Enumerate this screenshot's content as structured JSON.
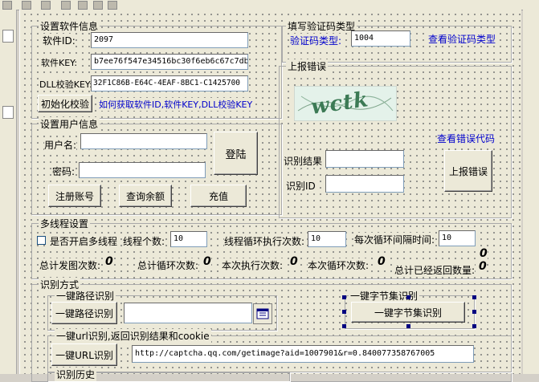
{
  "software": {
    "title": "设置软件信息",
    "id_label": "软件ID:",
    "id_value": "2097",
    "key_label": "软件KEY:",
    "key_value": "b7ee76f547e34516bc30f6eb6c67c7db",
    "dll_label": "DLL校验KEY:",
    "dll_value": "32F1C86B-E64C-4EAF-8BC1-C1425700",
    "init_button": "初始化校验",
    "howto_link": "如何获取软件ID,软件KEY,DLL校验KEY"
  },
  "user": {
    "title": "设置用户信息",
    "username_label": "用户名:",
    "username_value": "",
    "password_label": "密码:",
    "password_value": "",
    "login_button": "登陆",
    "register_button": "注册账号",
    "balance_button": "查询余额",
    "recharge_button": "充值"
  },
  "captcha_type": {
    "title": "填写验证码类型",
    "type_label": "验证码类型:",
    "type_value": "1004",
    "view_link": "查看验证码类型"
  },
  "report": {
    "title": "上报错误",
    "captcha_text": "wctk",
    "error_code_link": "查看错误代码",
    "result_label": "识别结果",
    "result_value": "",
    "id_label": "识别ID",
    "id_value": "",
    "report_button": "上报错误"
  },
  "multithread": {
    "title": "多线程设置",
    "enable_label": "是否开启多线程",
    "thread_count_label": "线程个数:",
    "thread_count_value": "10",
    "loop_count_label": "线程循环执行次数:",
    "loop_count_value": "10",
    "interval_label": "每次循环间隔时间:",
    "interval_value": "10",
    "total_sent_label": "总计发图次数:",
    "total_sent_value": "0",
    "total_loops_label": "总计循环次数:",
    "total_loops_value": "0",
    "current_exec_label": "本次执行次数:",
    "current_exec_value": "0",
    "current_loop_label": "本次循环次数:",
    "current_loop_value": "0",
    "returned_label": "总计已经返回数量:",
    "returned_value": "0",
    "returned_top_value": "0"
  },
  "recognition": {
    "title": "识别方式",
    "path_group_title": "一键路径识别",
    "path_button": "一键路径识别",
    "path_value": "",
    "bytes_group_title": "一键字节集识别",
    "bytes_button": "一键字节集识别",
    "url_group_title": "一键url识别,返回识别结果和cookie",
    "url_button": "一键URL识别",
    "url_value": "http://captcha.qq.com/getimage?aid=1007901&r=0.840077358767005",
    "bottom_cut_label": "识别历史"
  }
}
